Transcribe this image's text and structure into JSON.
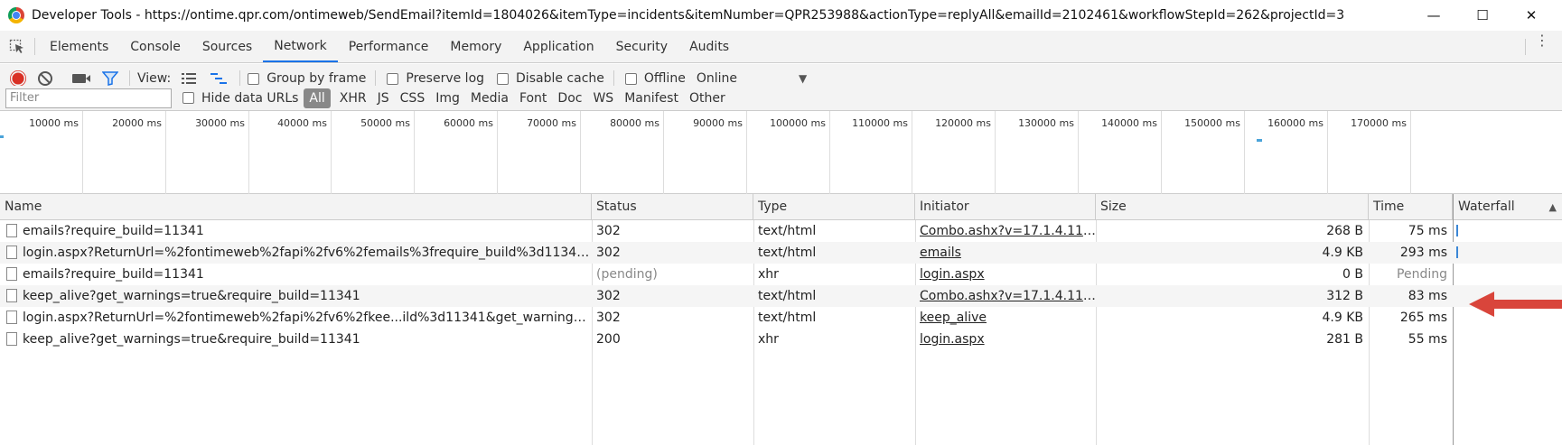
{
  "window": {
    "title": "Developer Tools - https://ontime.qpr.com/ontimeweb/SendEmail?itemId=1804026&itemType=incidents&itemNumber=QPR253988&actionType=replyAll&emailId=2102461&workflowStepId=262&projectId=3",
    "minimize": "—",
    "maximize": "☐",
    "close": "✕"
  },
  "tabs": [
    "Elements",
    "Console",
    "Sources",
    "Network",
    "Performance",
    "Memory",
    "Application",
    "Security",
    "Audits"
  ],
  "active_tab": "Network",
  "toolbar": {
    "view_label": "View:",
    "group_by_frame": "Group by frame",
    "preserve_log": "Preserve log",
    "disable_cache": "Disable cache",
    "offline": "Offline",
    "throttle": "Online"
  },
  "filter": {
    "placeholder": "Filter",
    "hide_data_urls": "Hide data URLs",
    "types": [
      "All",
      "XHR",
      "JS",
      "CSS",
      "Img",
      "Media",
      "Font",
      "Doc",
      "WS",
      "Manifest",
      "Other"
    ],
    "active_type": "All"
  },
  "overview": {
    "ticks": [
      "10000 ms",
      "20000 ms",
      "30000 ms",
      "40000 ms",
      "50000 ms",
      "60000 ms",
      "70000 ms",
      "80000 ms",
      "90000 ms",
      "100000 ms",
      "110000 ms",
      "120000 ms",
      "130000 ms",
      "140000 ms",
      "150000 ms",
      "160000 ms",
      "170000 ms"
    ]
  },
  "table": {
    "columns": [
      "Name",
      "Status",
      "Type",
      "Initiator",
      "Size",
      "Time",
      "Waterfall"
    ],
    "rows": [
      {
        "name": "emails?require_build=11341",
        "status": "302",
        "type": "text/html",
        "initiator": "Combo.ashx?v=17.1.4.113...",
        "size": "268 B",
        "time": "75 ms"
      },
      {
        "name": "login.aspx?ReturnUrl=%2fontimeweb%2fapi%2fv6%2femails%3frequire_build%3d11341&re...",
        "status": "302",
        "type": "text/html",
        "initiator": "emails",
        "size": "4.9 KB",
        "time": "293 ms"
      },
      {
        "name": "emails?require_build=11341",
        "status": "(pending)",
        "type": "xhr",
        "initiator": "login.aspx",
        "size": "0 B",
        "time": "Pending"
      },
      {
        "name": "keep_alive?get_warnings=true&require_build=11341",
        "status": "302",
        "type": "text/html",
        "initiator": "Combo.ashx?v=17.1.4.113...",
        "size": "312 B",
        "time": "83 ms"
      },
      {
        "name": "login.aspx?ReturnUrl=%2fontimeweb%2fapi%2fv6%2fkee...ild%3d11341&get_warnings=tru...",
        "status": "302",
        "type": "text/html",
        "initiator": "keep_alive",
        "size": "4.9 KB",
        "time": "265 ms"
      },
      {
        "name": "keep_alive?get_warnings=true&require_build=11341",
        "status": "200",
        "type": "xhr",
        "initiator": "login.aspx",
        "size": "281 B",
        "time": "55 ms"
      }
    ]
  },
  "colors": {
    "record": "#d93025",
    "active_tab_underline": "#1a73e8",
    "annotation_arrow": "#d9453b",
    "waterfall_bar": "#3b87d6"
  }
}
